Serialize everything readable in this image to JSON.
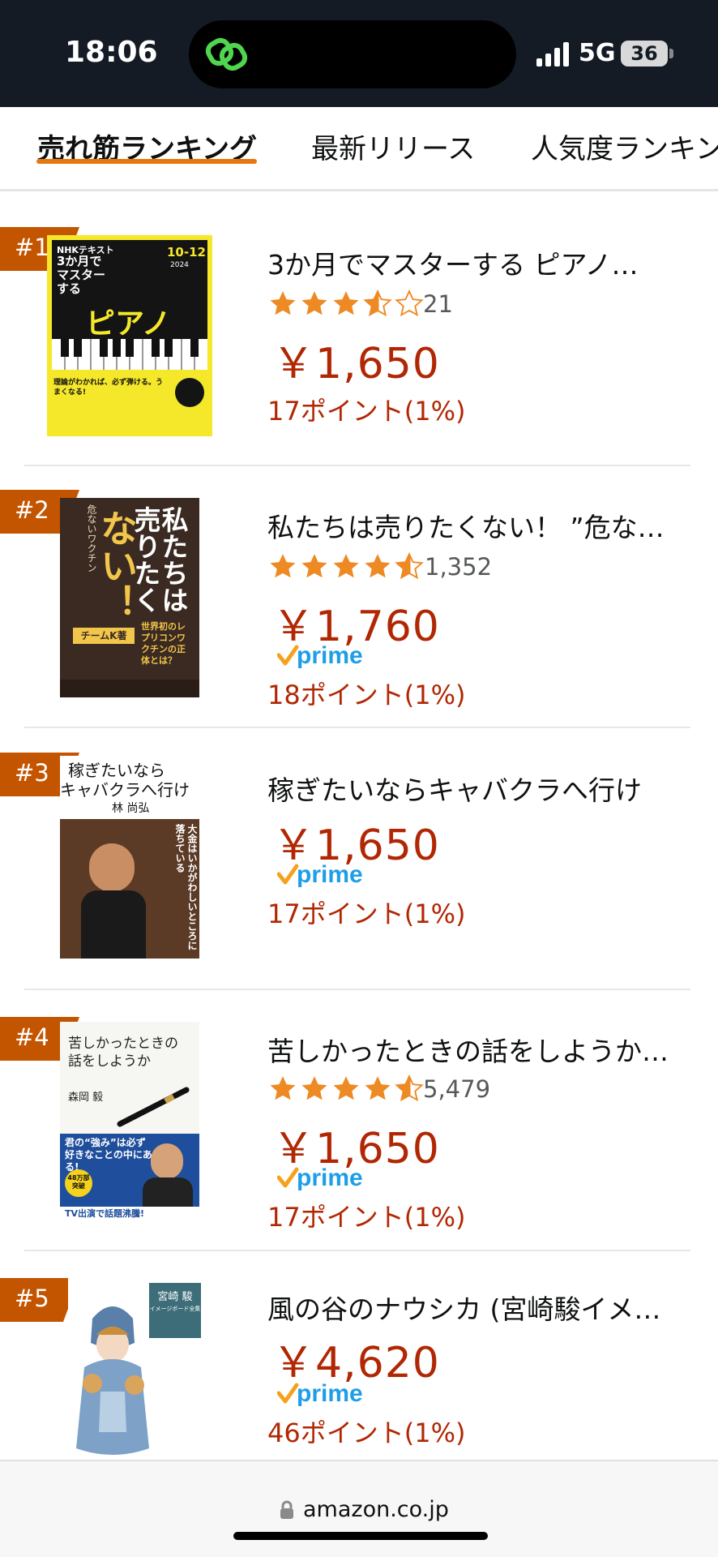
{
  "status_bar": {
    "time": "18:06",
    "network": "5G",
    "battery": "36"
  },
  "tabs": [
    {
      "label": "売れ筋ランキング",
      "active": true
    },
    {
      "label": "最新リリース",
      "active": false
    },
    {
      "label": "人気度ランキング",
      "active": false
    }
  ],
  "colors": {
    "accent": "#e47911",
    "price": "#b12704",
    "star": "#ee8a24",
    "prime": "#1e9ee8",
    "prime_check": "#f4a21d"
  },
  "products": [
    {
      "rank": "#1",
      "title": "3か月でマスターする ピアノ…",
      "rating": 3.5,
      "rating_count": "21",
      "price": "￥1,650",
      "prime": false,
      "points": "17ポイント(1%)",
      "cover": {
        "series": "NHKテキスト",
        "line1": "3か月で",
        "line2": "マスター",
        "line3": "する",
        "main": "ピアノ",
        "period": "10-12",
        "year": "2024",
        "tagline": "理論がわかれば、必ず弾ける。うまくなる!"
      }
    },
    {
      "rank": "#2",
      "title": "私たちは売りたくない！ ”危な…",
      "rating": 4.5,
      "rating_count": "1,352",
      "price": "￥1,760",
      "prime": true,
      "points": "18ポイント(1%)",
      "cover": {
        "main1": "私たちは",
        "main2": "売りたく",
        "main3": "ない！",
        "author": "チームK著",
        "side": "世界初のレプリコンワクチンの正体とは？"
      }
    },
    {
      "rank": "#3",
      "title": "稼ぎたいならキャバクラへ行け",
      "rating": null,
      "rating_count": "",
      "price": "￥1,650",
      "prime": true,
      "points": "17ポイント(1%)",
      "cover": {
        "line1": "稼ぎたいなら",
        "line2": "キャバクラへ行け",
        "author": "林 尚弘",
        "side": "大金はいかがわしいところに落ちている"
      }
    },
    {
      "rank": "#4",
      "title": "苦しかったときの話をしようか…",
      "rating": 4.5,
      "rating_count": "5,479",
      "price": "￥1,650",
      "prime": true,
      "points": "17ポイント(1%)",
      "cover": {
        "line1": "苦しかったときの",
        "line2": "話をしようか",
        "author": "森岡 毅",
        "band": "君の“強み”は必ず好きなことの中にある!",
        "badge": "48万部突破",
        "footer": "TV出演で話題沸騰!"
      }
    },
    {
      "rank": "#5",
      "title": "風の谷のナウシカ (宮崎駿イメ…",
      "rating": null,
      "rating_count": "",
      "price": "￥4,620",
      "prime": true,
      "points": "46ポイント(1%)",
      "cover": {
        "line1": "宮崎 駿",
        "line2": "イメージボード全集"
      }
    }
  ],
  "prime_label": "prime",
  "bottom_bar": {
    "url": "amazon.co.jp"
  }
}
